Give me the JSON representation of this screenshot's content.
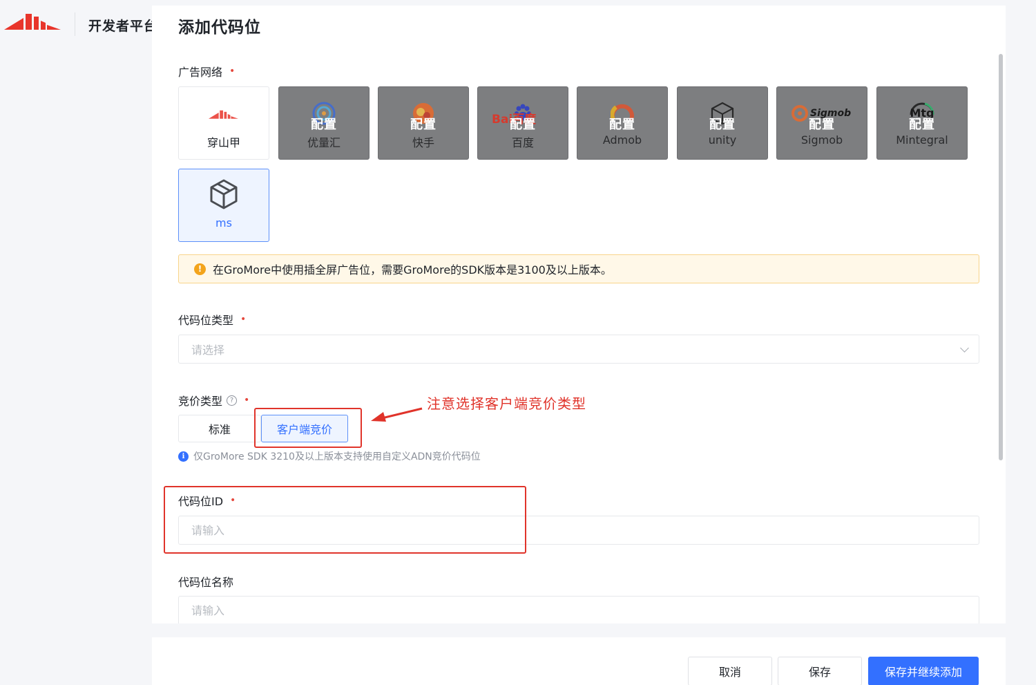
{
  "header": {
    "brand_title": "开发者平台"
  },
  "page": {
    "title": "添加代码位"
  },
  "ad_network": {
    "label": "广告网络",
    "required_mark": "•",
    "config_label": "配置",
    "items": [
      {
        "name": "穿山甲",
        "state": "normal"
      },
      {
        "name": "优量汇",
        "state": "dimmed"
      },
      {
        "name": "快手",
        "state": "dimmed"
      },
      {
        "name": "百度",
        "state": "dimmed",
        "logo_text": "Bai百度"
      },
      {
        "name": "Admob",
        "state": "dimmed"
      },
      {
        "name": "unity",
        "state": "dimmed"
      },
      {
        "name": "Sigmob",
        "state": "dimmed",
        "logo_text": "Sigmob"
      },
      {
        "name": "Mintegral",
        "state": "dimmed",
        "logo_text": "Mtg"
      },
      {
        "name": "ms",
        "state": "selected"
      }
    ]
  },
  "warning": {
    "text": "在GroMore中使用插全屏广告位，需要GroMore的SDK版本是3100及以上版本。"
  },
  "slot_type": {
    "label": "代码位类型",
    "required_mark": "•",
    "placeholder": "请选择"
  },
  "bid_type": {
    "label": "竞价类型",
    "help_glyph": "?",
    "required_mark": "•",
    "options": [
      "标准",
      "客户端竞价"
    ],
    "selected": "客户端竞价",
    "note": "仅GroMore SDK 3210及以上版本支持使用自定义ADN竞价代码位"
  },
  "annotation": {
    "text": "注意选择客户端竞价类型"
  },
  "slot_id": {
    "label": "代码位ID",
    "required_mark": "•",
    "placeholder": "请输入"
  },
  "slot_name": {
    "label": "代码位名称",
    "placeholder": "请输入"
  },
  "footer": {
    "cancel": "取消",
    "save": "保存",
    "save_continue": "保存并继续添加"
  },
  "colors": {
    "primary": "#3370ff",
    "annotation_red": "#e0332a",
    "warning_bg": "#fff8e8",
    "required": "#e5483d"
  }
}
